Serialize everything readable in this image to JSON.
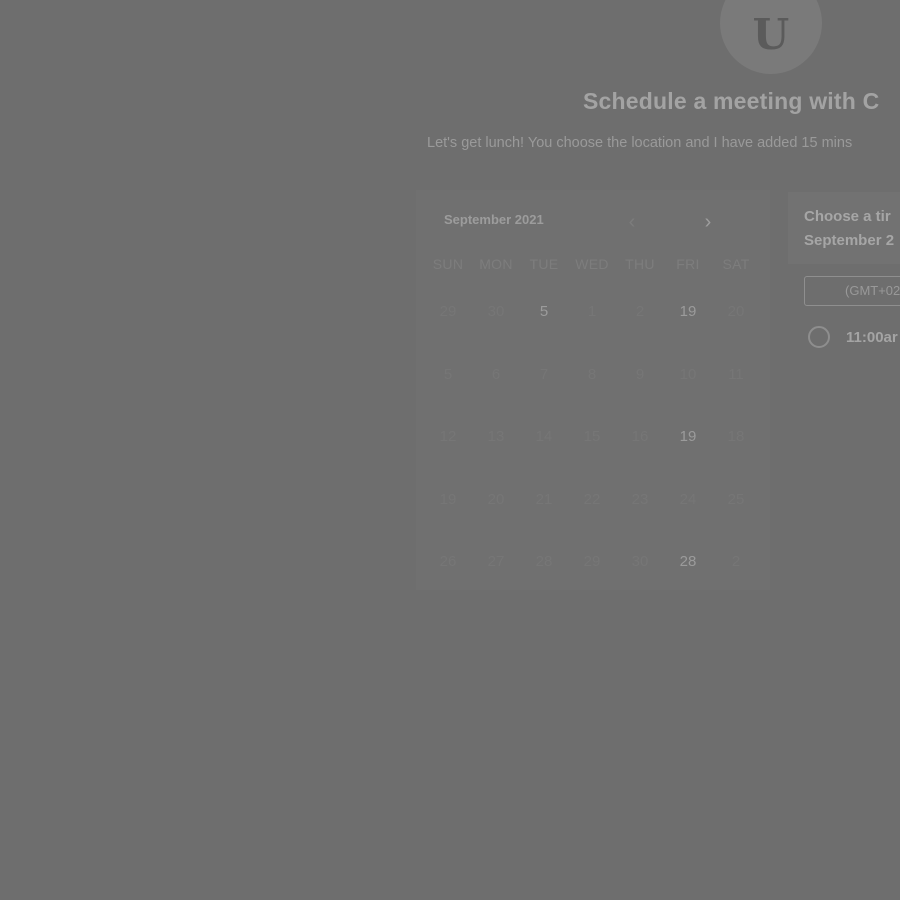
{
  "profile": {
    "avatar_letter": "U"
  },
  "header": {
    "title": "Schedule a meeting with C",
    "subtitle": "Let's get lunch! You choose the location and I have added 15 mins"
  },
  "calendar": {
    "month_label": "September 2021",
    "prev_icon": "‹",
    "next_icon": "›",
    "weekdays": [
      "SUN",
      "MON",
      "TUE",
      "WED",
      "THU",
      "FRI",
      "SAT"
    ],
    "weeks": [
      [
        "29",
        "30",
        "5",
        "1",
        "2",
        "19",
        "20"
      ],
      [
        "5",
        "6",
        "7",
        "8",
        "9",
        "10",
        "11"
      ],
      [
        "12",
        "13",
        "14",
        "15",
        "16",
        "19",
        "18"
      ],
      [
        "19",
        "20",
        "21",
        "22",
        "23",
        "24",
        "25"
      ],
      [
        "26",
        "27",
        "28",
        "29",
        "30",
        "28",
        "2"
      ]
    ],
    "available_days": [
      "5",
      "19",
      "28"
    ]
  },
  "time_panel": {
    "heading_line1": "Choose a tir",
    "heading_line2": "September 2",
    "timezone": "(GMT+02",
    "slots": [
      "11:00ar"
    ]
  }
}
